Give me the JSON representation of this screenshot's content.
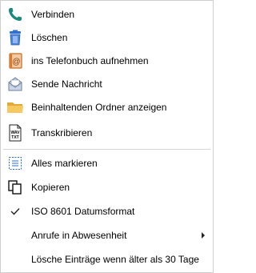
{
  "menu": {
    "items": [
      {
        "label": "Verbinden",
        "icon": "phone-icon"
      },
      {
        "label": "Löschen",
        "icon": "trash-icon"
      },
      {
        "label": "ins Telefonbuch aufnehmen",
        "icon": "address-book-icon"
      },
      {
        "label": "Sende Nachricht",
        "icon": "envelope-icon"
      },
      {
        "label": "Beinhaltenden Ordner anzeigen",
        "icon": "folder-icon"
      },
      {
        "label": "Transkribieren",
        "icon": "wav-txt-icon"
      },
      {
        "label": "Alles markieren",
        "icon": "select-all-icon"
      },
      {
        "label": "Kopieren",
        "icon": "copy-icon"
      },
      {
        "label": "ISO 8601 Datumsformat",
        "icon": "checkmark-icon",
        "checked": true
      },
      {
        "label": "Anrufe in Abwesenheit",
        "icon": "submenu-arrow-icon",
        "has_submenu": true
      },
      {
        "label": "Lösche Einträge wenn älter als 30 Tage",
        "icon": ""
      }
    ],
    "icon_text": {
      "wav": "WAV",
      "txt": "TXT"
    },
    "colors": {
      "phone": "#1b8a7a",
      "trash": "#2e6fd1",
      "address_book": "#e07a2a",
      "folder": "#f2c04d"
    }
  }
}
